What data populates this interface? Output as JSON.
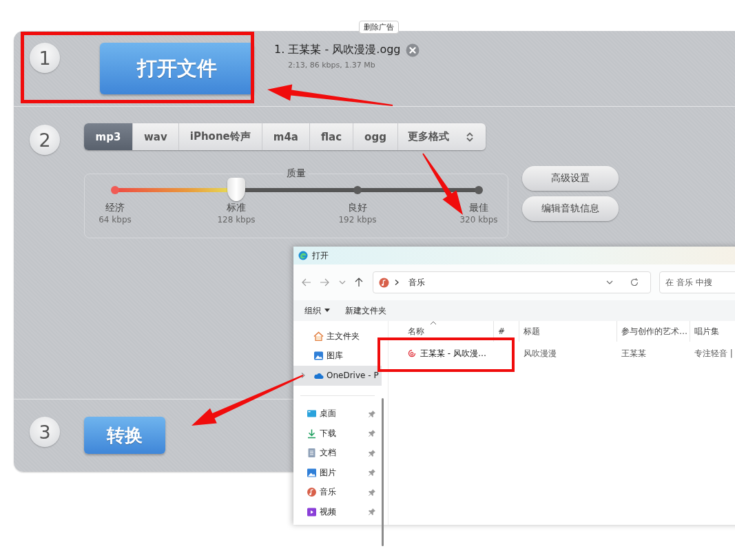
{
  "ad_button": "删除广告",
  "step1": {
    "number": "1",
    "open_button": "打开文件",
    "files": [
      {
        "name": "1. 王某某 - 风吹漫漫.ogg",
        "info": "2:13, 86 kbps, 1.37 Mb"
      }
    ]
  },
  "step2": {
    "number": "2",
    "formats": [
      {
        "label": "mp3",
        "selected": true
      },
      {
        "label": "wav",
        "selected": false
      },
      {
        "label": "iPhone铃声",
        "selected": false
      },
      {
        "label": "m4a",
        "selected": false
      },
      {
        "label": "flac",
        "selected": false
      },
      {
        "label": "ogg",
        "selected": false
      }
    ],
    "more_formats": "更多格式",
    "quality": {
      "legend": "质量",
      "level": 0.3333,
      "stops": [
        {
          "name": "经济",
          "bitrate": "64 kbps"
        },
        {
          "name": "标准",
          "bitrate": "128 kbps"
        },
        {
          "name": "良好",
          "bitrate": "192 kbps"
        },
        {
          "name": "最佳",
          "bitrate": "320 kbps"
        }
      ]
    },
    "buttons": [
      "高级设置",
      "编辑音轨信息"
    ]
  },
  "step3": {
    "number": "3",
    "convert_button": "转换"
  },
  "dialog": {
    "title": "打开",
    "address": "音乐",
    "search_placeholder": "在 音乐 中搜",
    "toolbar": [
      "组织",
      "新建文件夹"
    ],
    "places": [
      {
        "label": "主文件夹",
        "kind": "home",
        "selected": false
      },
      {
        "label": "图库",
        "kind": "gallery",
        "selected": false
      },
      {
        "label": "OneDrive - P",
        "kind": "cloud",
        "selected": true,
        "expanded": false
      }
    ],
    "quick_access": [
      {
        "label": "桌面",
        "kind": "desktop",
        "pinned": true
      },
      {
        "label": "下载",
        "kind": "download",
        "pinned": true
      },
      {
        "label": "文档",
        "kind": "document",
        "pinned": true
      },
      {
        "label": "图片",
        "kind": "pictures",
        "pinned": true
      },
      {
        "label": "音乐",
        "kind": "music",
        "pinned": true
      },
      {
        "label": "视频",
        "kind": "video",
        "pinned": true
      }
    ],
    "columns": [
      "名称",
      "#",
      "标题",
      "参与创作的艺术…",
      "唱片集"
    ],
    "rows": [
      {
        "cells": [
          "王某某 - 风吹漫…",
          "",
          "风吹漫漫",
          "王某某",
          "专注轻音 |"
        ]
      }
    ]
  }
}
